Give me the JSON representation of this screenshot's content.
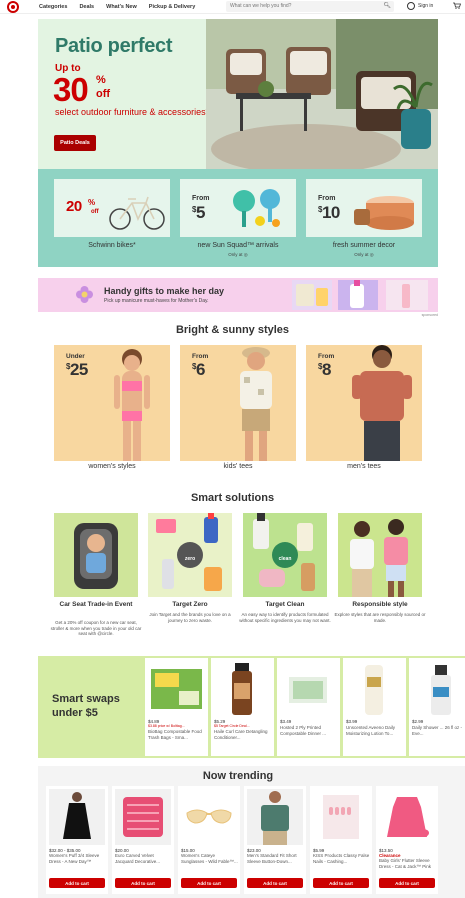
{
  "nav": {
    "items": [
      "Categories",
      "Deals",
      "What's New",
      "Pickup & Delivery"
    ],
    "search_placeholder": "What can we help you find?",
    "signin": "Sign in"
  },
  "hero": {
    "title": "Patio perfect",
    "up_to": "Up to",
    "percent": "30",
    "percent_sign": "%",
    "off": "off",
    "subtitle": "select outdoor furniture & accessories*",
    "button": "Patio Deals"
  },
  "offers": [
    {
      "big": "20",
      "sign": "%",
      "off": "off",
      "caption": "Schwinn bikes*",
      "sub": ""
    },
    {
      "from": "From",
      "dollar": "$",
      "value": "5",
      "caption": "new Sun Squad™ arrivals",
      "sub": "Only at ◎"
    },
    {
      "from": "From",
      "dollar": "$",
      "value": "10",
      "caption": "fresh summer decor",
      "sub": "Only at ◎"
    }
  ],
  "banner": {
    "title": "Handy gifts to make her day",
    "subtitle": "Pick up manicure must-haves for Mother's Day.",
    "ad": "sponsored"
  },
  "bright": {
    "title": "Bright & sunny styles",
    "cards": [
      {
        "from": "Under",
        "dollar": "$",
        "value": "25",
        "label": "women's styles"
      },
      {
        "from": "From",
        "dollar": "$",
        "value": "6",
        "label": "kids' tees"
      },
      {
        "from": "From",
        "dollar": "$",
        "value": "8",
        "label": "men's tees"
      }
    ]
  },
  "solutions": {
    "title": "Smart solutions",
    "items": [
      {
        "title": "Car Seat Trade-in Event",
        "desc": "Get a 20% off coupon for a new car seat, stroller & more when you trade in your old car seat with @circle."
      },
      {
        "title": "Target Zero",
        "desc": "Join Target and the brands you love on a journey to zero waste."
      },
      {
        "title": "Target Clean",
        "desc": "An easy way to identify products formulated without specific ingredients you may not want."
      },
      {
        "title": "Responsible style",
        "desc": "Explore styles that are responsibly sourced or made."
      }
    ],
    "zero_badge": "zero",
    "clean_badge": "clean"
  },
  "swaps": {
    "title": "Smart swaps under $5",
    "products": [
      {
        "price": "$4.89",
        "sale": "$3.88 price w/ Bolttag...",
        "name": "BioBag Compostable Food Trash Bags - Sma..."
      },
      {
        "price": "$5.29",
        "sale": "$5 Target Circle Deal...",
        "name": "Haile Curl Care Detangling Conditioner..."
      },
      {
        "price": "$3.49",
        "sale": "",
        "name": "Hosted 2 Ply Printed Compostable Dinner ..."
      },
      {
        "price": "$3.99",
        "sale": "",
        "name": "Unscented Aveeno Daily Moisturizing Lotion To..."
      },
      {
        "price": "$2.99",
        "sale": "",
        "name": "Daily Shower ... 26 fl oz - Eve..."
      }
    ]
  },
  "trending": {
    "title": "Now trending",
    "add_label": "Add to cart",
    "products": [
      {
        "price": "$32.00 - $35.00",
        "clearance": "",
        "name": "Women's Puff 3/4 Sleeve Dress - A New Day™"
      },
      {
        "price": "$20.00",
        "clearance": "",
        "name": "Euro Carved Velvet Jacquard Decorative..."
      },
      {
        "price": "$15.00",
        "clearance": "",
        "name": "Women's Cateye Sunglasses - Wild Fable™..."
      },
      {
        "price": "$23.00",
        "clearance": "",
        "name": "Men's Standard Fit Short Sleeve Button-Down..."
      },
      {
        "price": "$5.99",
        "clearance": "",
        "name": "KISS Products Classy False Nails - Cashing..."
      },
      {
        "price": "$13.50",
        "clearance": "Clearance",
        "name": "Baby Girls' Flutter Sleeve Dress - Cat & Jack™ Pink"
      }
    ]
  },
  "colors": {
    "brand_red": "#cc0000",
    "hero_bg": "#e3f4e2",
    "teal": "#8fd3c3",
    "pink": "#f7d0ec",
    "peach": "#f8d7a0",
    "lime": "#d6eca5"
  }
}
